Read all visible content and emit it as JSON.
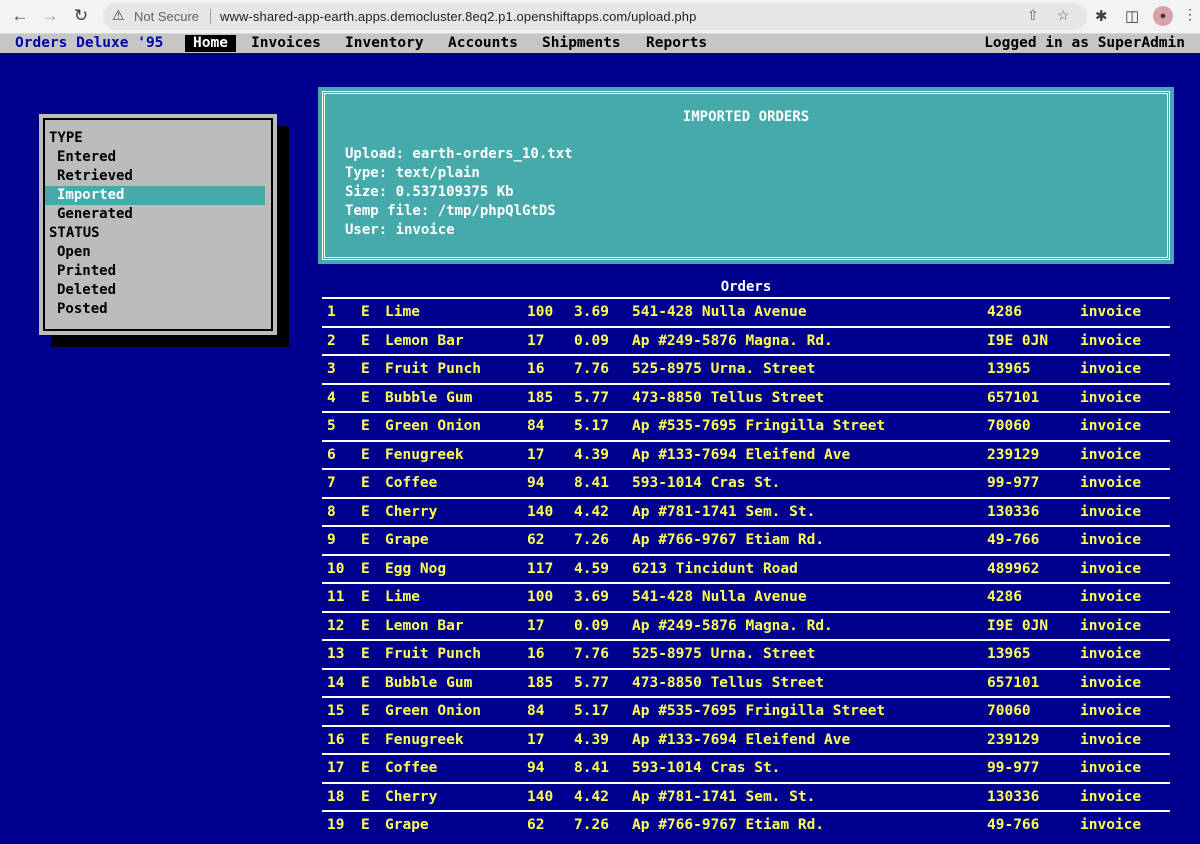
{
  "browser": {
    "security_label": "Not Secure",
    "url": "www-shared-app-earth.apps.democluster.8eq2.p1.openshiftapps.com/upload.php"
  },
  "menubar": {
    "app_title": "Orders Deluxe '95",
    "items": [
      "Home",
      "Invoices",
      "Inventory",
      "Accounts",
      "Shipments",
      "Reports"
    ],
    "active_item": "Home",
    "logged_in": "Logged in as SuperAdmin"
  },
  "sidebar": {
    "type_heading": "TYPE",
    "type_items": [
      "Entered",
      "Retrieved",
      "Imported",
      "Generated"
    ],
    "selected_item": "Imported",
    "status_heading": "STATUS",
    "status_items": [
      "Open",
      "Printed",
      "Deleted",
      "Posted"
    ]
  },
  "info": {
    "title": "IMPORTED ORDERS",
    "upload": "Upload: earth-orders_10.txt",
    "type": "Type: text/plain",
    "size": "Size: 0.537109375 Kb",
    "temp_file": "Temp file: /tmp/phpQlGtDS",
    "user": "User: invoice"
  },
  "orders": {
    "title": "Orders",
    "rows": [
      {
        "num": "1",
        "type": "E",
        "name": "Lime",
        "qty": "100",
        "price": "3.69",
        "address": "541-428 Nulla Avenue",
        "zip": "4286",
        "user": "invoice"
      },
      {
        "num": "2",
        "type": "E",
        "name": "Lemon Bar",
        "qty": "17",
        "price": "0.09",
        "address": "Ap #249-5876 Magna. Rd.",
        "zip": "I9E 0JN",
        "user": "invoice"
      },
      {
        "num": "3",
        "type": "E",
        "name": "Fruit Punch",
        "qty": "16",
        "price": "7.76",
        "address": "525-8975 Urna. Street",
        "zip": "13965",
        "user": "invoice"
      },
      {
        "num": "4",
        "type": "E",
        "name": "Bubble Gum",
        "qty": "185",
        "price": "5.77",
        "address": "473-8850 Tellus Street",
        "zip": "657101",
        "user": "invoice"
      },
      {
        "num": "5",
        "type": "E",
        "name": "Green Onion",
        "qty": "84",
        "price": "5.17",
        "address": "Ap #535-7695 Fringilla Street",
        "zip": "70060",
        "user": "invoice"
      },
      {
        "num": "6",
        "type": "E",
        "name": "Fenugreek",
        "qty": "17",
        "price": "4.39",
        "address": "Ap #133-7694 Eleifend Ave",
        "zip": "239129",
        "user": "invoice"
      },
      {
        "num": "7",
        "type": "E",
        "name": "Coffee",
        "qty": "94",
        "price": "8.41",
        "address": "593-1014 Cras St.",
        "zip": "99-977",
        "user": "invoice"
      },
      {
        "num": "8",
        "type": "E",
        "name": "Cherry",
        "qty": "140",
        "price": "4.42",
        "address": "Ap #781-1741 Sem. St.",
        "zip": "130336",
        "user": "invoice"
      },
      {
        "num": "9",
        "type": "E",
        "name": "Grape",
        "qty": "62",
        "price": "7.26",
        "address": "Ap #766-9767 Etiam Rd.",
        "zip": "49-766",
        "user": "invoice"
      },
      {
        "num": "10",
        "type": "E",
        "name": "Egg Nog",
        "qty": "117",
        "price": "4.59",
        "address": "6213 Tincidunt Road",
        "zip": "489962",
        "user": "invoice"
      },
      {
        "num": "11",
        "type": "E",
        "name": "Lime",
        "qty": "100",
        "price": "3.69",
        "address": "541-428 Nulla Avenue",
        "zip": "4286",
        "user": "invoice"
      },
      {
        "num": "12",
        "type": "E",
        "name": "Lemon Bar",
        "qty": "17",
        "price": "0.09",
        "address": "Ap #249-5876 Magna. Rd.",
        "zip": "I9E 0JN",
        "user": "invoice"
      },
      {
        "num": "13",
        "type": "E",
        "name": "Fruit Punch",
        "qty": "16",
        "price": "7.76",
        "address": "525-8975 Urna. Street",
        "zip": "13965",
        "user": "invoice"
      },
      {
        "num": "14",
        "type": "E",
        "name": "Bubble Gum",
        "qty": "185",
        "price": "5.77",
        "address": "473-8850 Tellus Street",
        "zip": "657101",
        "user": "invoice"
      },
      {
        "num": "15",
        "type": "E",
        "name": "Green Onion",
        "qty": "84",
        "price": "5.17",
        "address": "Ap #535-7695 Fringilla Street",
        "zip": "70060",
        "user": "invoice"
      },
      {
        "num": "16",
        "type": "E",
        "name": "Fenugreek",
        "qty": "17",
        "price": "4.39",
        "address": "Ap #133-7694 Eleifend Ave",
        "zip": "239129",
        "user": "invoice"
      },
      {
        "num": "17",
        "type": "E",
        "name": "Coffee",
        "qty": "94",
        "price": "8.41",
        "address": "593-1014 Cras St.",
        "zip": "99-977",
        "user": "invoice"
      },
      {
        "num": "18",
        "type": "E",
        "name": "Cherry",
        "qty": "140",
        "price": "4.42",
        "address": "Ap #781-1741 Sem. St.",
        "zip": "130336",
        "user": "invoice"
      },
      {
        "num": "19",
        "type": "E",
        "name": "Grape",
        "qty": "62",
        "price": "7.26",
        "address": "Ap #766-9767 Etiam Rd.",
        "zip": "49-766",
        "user": "invoice"
      }
    ]
  },
  "colors": {
    "page_bg": "#00008e",
    "menubar_bg": "#c6c6c6",
    "accent_teal": "#46a9aa",
    "row_text": "#ffff55"
  }
}
